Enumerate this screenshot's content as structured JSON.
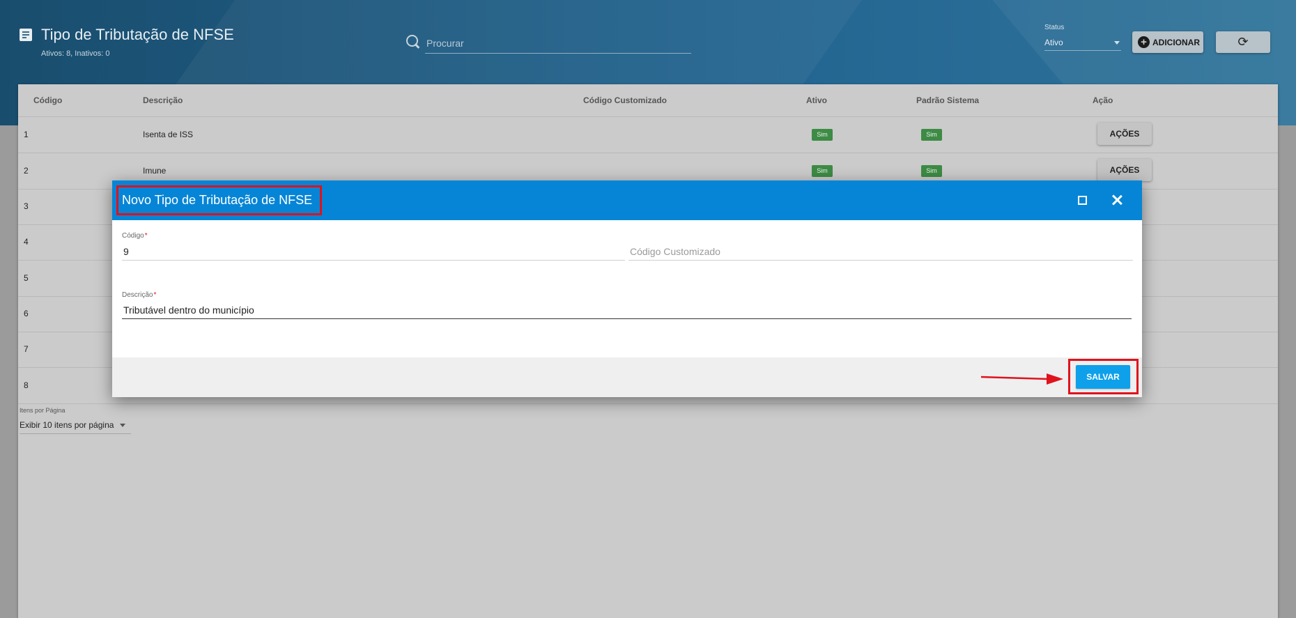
{
  "header": {
    "title": "Tipo de Tributação de NFSE",
    "subtitle": "Ativos: 8, Inativos: 0",
    "search_placeholder": "Procurar",
    "status_label": "Status",
    "status_value": "Ativo",
    "add_label": "ADICIONAR",
    "refresh_glyph": "⟳"
  },
  "table": {
    "columns": {
      "codigo": "Código",
      "descricao": "Descrição",
      "codigo_customizado": "Código Customizado",
      "ativo": "Ativo",
      "padrao_sistema": "Padrão Sistema",
      "acao": "Ação"
    },
    "rows": [
      {
        "codigo": "1",
        "descricao": "Isenta de ISS",
        "ativo": "Sim",
        "padrao": "Sim",
        "acao": "AÇÕES"
      },
      {
        "codigo": "2",
        "descricao": "Imune",
        "ativo": "Sim",
        "padrao": "Sim",
        "acao": "AÇÕES"
      },
      {
        "codigo": "3"
      },
      {
        "codigo": "4"
      },
      {
        "codigo": "5"
      },
      {
        "codigo": "6"
      },
      {
        "codigo": "7"
      },
      {
        "codigo": "8"
      }
    ],
    "items_per_page_label": "Itens por Página",
    "items_per_page_value": "Exibir 10 itens por página"
  },
  "modal": {
    "title": "Novo Tipo de Tributação de NFSE",
    "codigo_label": "Código",
    "codigo_value": "9",
    "codigo_customizado_placeholder": "Código Customizado",
    "descricao_label": "Descrição",
    "descricao_value": "Tributável dentro do município",
    "required_mark": "*",
    "save_label": "SALVAR"
  },
  "colors": {
    "modal_header": "#0685d6",
    "save_button": "#0ea0ea",
    "badge_green": "#3d8b45",
    "highlight_red": "#e0121c"
  }
}
